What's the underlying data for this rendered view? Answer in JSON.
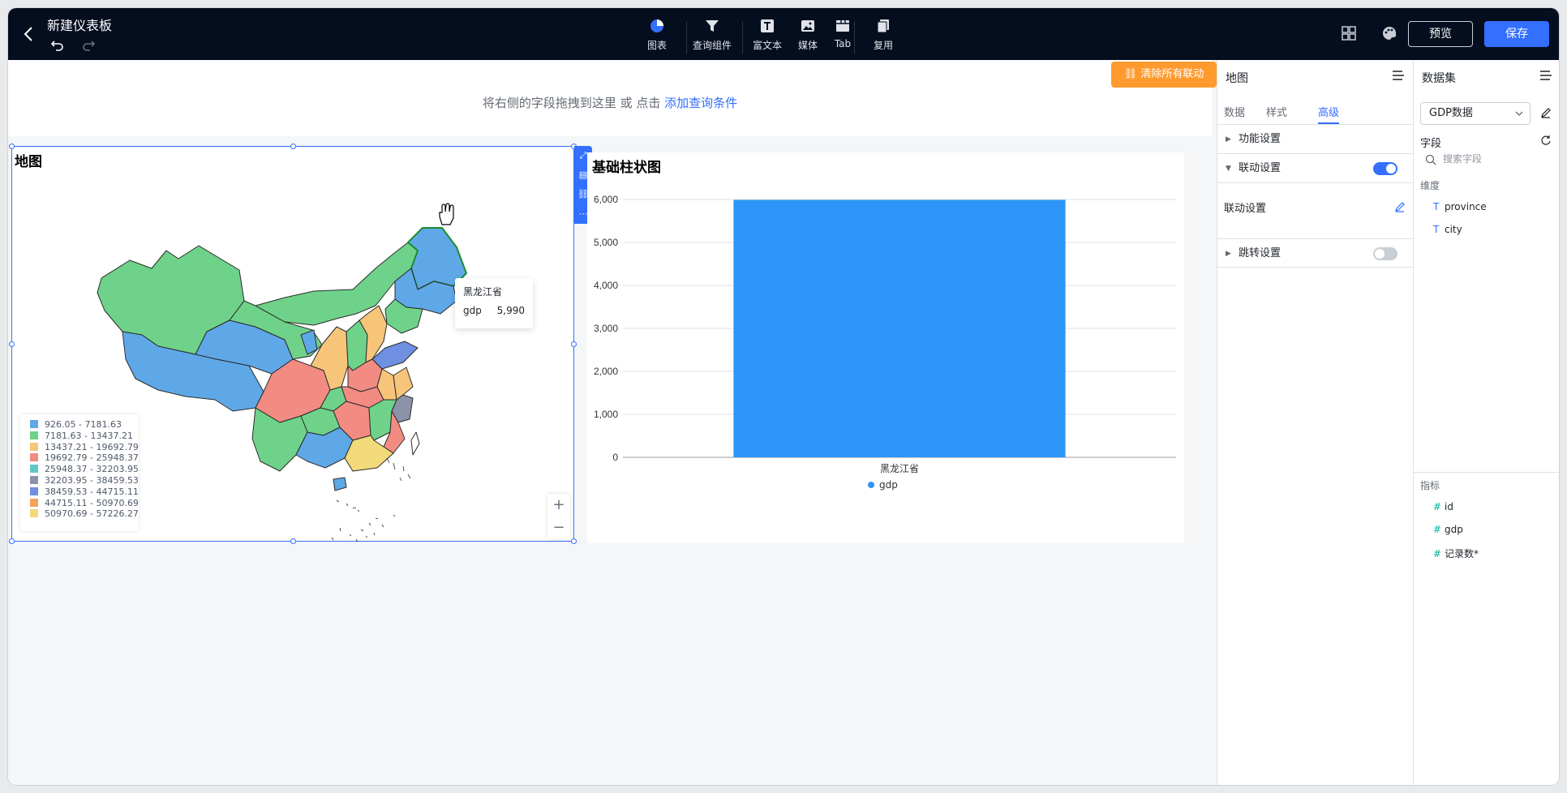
{
  "topbar": {
    "title": "新建仪表板",
    "tools": [
      {
        "icon": "pie-chart-icon",
        "label": "图表"
      },
      {
        "icon": "filter-icon",
        "label": "查询组件"
      },
      {
        "icon": "text-icon",
        "label": "富文本"
      },
      {
        "icon": "image-icon",
        "label": "媒体"
      },
      {
        "icon": "tab-icon",
        "label": "Tab"
      },
      {
        "icon": "copy-icon",
        "label": "复用"
      }
    ],
    "preview_label": "预览",
    "save_label": "保存"
  },
  "query_bar": {
    "hint": "将右侧的字段拖拽到这里 或 点击",
    "link": "添加查询条件"
  },
  "clear_linkage_label": "清除所有联动",
  "map_card": {
    "title": "地图",
    "legend": [
      {
        "label": "926.05 - 7181.63",
        "color": "#5fa8e8"
      },
      {
        "label": "7181.63 - 13437.21",
        "color": "#6fd28a"
      },
      {
        "label": "13437.21 - 19692.79",
        "color": "#f7c57a"
      },
      {
        "label": "19692.79 - 25948.37",
        "color": "#f28b82"
      },
      {
        "label": "25948.37 - 32203.95",
        "color": "#5ec8c8"
      },
      {
        "label": "32203.95 - 38459.53",
        "color": "#8c92a8"
      },
      {
        "label": "38459.53 - 44715.11",
        "color": "#6f8fe0"
      },
      {
        "label": "44715.11 - 50970.69",
        "color": "#f5a35c"
      },
      {
        "label": "50970.69 - 57226.27",
        "color": "#f2da7a"
      }
    ],
    "tooltip": {
      "title": "黑龙江省",
      "key": "gdp",
      "value": "5,990"
    },
    "zoom_in": "+",
    "zoom_out": "−"
  },
  "bar_card": {
    "title": "基础柱状图"
  },
  "chart_data": {
    "type": "bar",
    "categories": [
      "黑龙江省"
    ],
    "series": [
      {
        "name": "gdp",
        "values": [
          5990
        ]
      }
    ],
    "title": "基础柱状图",
    "ylim": [
      0,
      6000
    ],
    "yticks": [
      "0",
      "1,000",
      "2,000",
      "3,000",
      "4,000",
      "5,000",
      "6,000"
    ],
    "color": "#2d95f7",
    "legend": "bottom-center",
    "grid": true
  },
  "attr_panel": {
    "title": "地图",
    "tabs": [
      "数据",
      "样式",
      "高级"
    ],
    "active_tab": "高级",
    "sections": [
      {
        "label": "功能设置",
        "expanded": false
      },
      {
        "label": "联动设置",
        "expanded": true,
        "toggle": true
      },
      {
        "label": "跳转设置",
        "expanded": false,
        "toggle": false
      }
    ],
    "linkage_sub_label": "联动设置"
  },
  "dataset_panel": {
    "title": "数据集",
    "dataset": "GDP数据",
    "fields_label": "字段",
    "search_placeholder": "搜索字段",
    "dimension_label": "维度",
    "dimensions": [
      "province",
      "city"
    ],
    "metric_label": "指标",
    "metrics": [
      "id",
      "gdp",
      "记录数*"
    ]
  },
  "colors": {
    "accent": "#3370ff",
    "topbar": "#050e1f",
    "bar": "#2d95f7",
    "warning": "#ff9a2e"
  }
}
